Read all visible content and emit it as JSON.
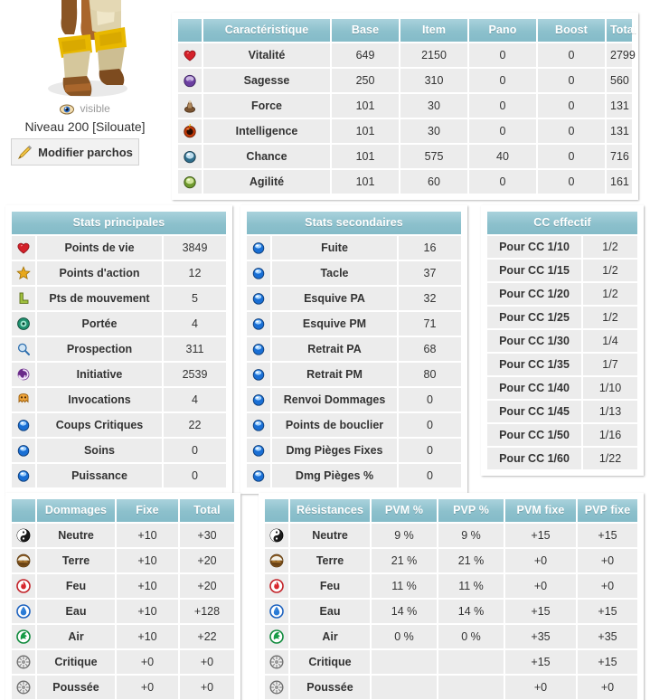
{
  "character": {
    "visibility_label": "visible",
    "visibility_icon": "eye-icon",
    "level_label": "Niveau 200 [Silouate]",
    "edit_button_label": "Modifier parchos",
    "edit_button_icon": "pencil-icon",
    "sprite_icon": "character-sprite"
  },
  "colors": {
    "header_teal": "#8cc0cc",
    "total_green_bg": "#e8f5d6",
    "total_green_text": "#4a6b2f",
    "label_gray": "#8d8d8d",
    "cell_bg": "#ececec",
    "label_bg": "#d9d9d9"
  },
  "caracteristiques": {
    "headers": [
      "Caractéristique",
      "Base",
      "Item",
      "Pano",
      "Boost",
      "Total"
    ],
    "rows": [
      {
        "icon": "heart-icon",
        "label": "Vitalité",
        "base": "649",
        "item": "2150",
        "pano": "0",
        "boost": "0",
        "total": "2799"
      },
      {
        "icon": "wisdom-orb-icon",
        "label": "Sagesse",
        "base": "250",
        "item": "310",
        "pano": "0",
        "boost": "0",
        "total": "560"
      },
      {
        "icon": "strength-icon",
        "label": "Force",
        "base": "101",
        "item": "30",
        "pano": "0",
        "boost": "0",
        "total": "131"
      },
      {
        "icon": "intelligence-icon",
        "label": "Intelligence",
        "base": "101",
        "item": "30",
        "pano": "0",
        "boost": "0",
        "total": "131"
      },
      {
        "icon": "chance-icon",
        "label": "Chance",
        "base": "101",
        "item": "575",
        "pano": "40",
        "boost": "0",
        "total": "716"
      },
      {
        "icon": "agility-icon",
        "label": "Agilité",
        "base": "101",
        "item": "60",
        "pano": "0",
        "boost": "0",
        "total": "161"
      }
    ]
  },
  "stats_principales": {
    "title": "Stats principales",
    "rows": [
      {
        "icon": "heart-icon",
        "label": "Points de vie",
        "value": "3849"
      },
      {
        "icon": "star-icon",
        "label": "Points d'action",
        "value": "12"
      },
      {
        "icon": "boot-icon",
        "label": "Pts de mouvement",
        "value": "5"
      },
      {
        "icon": "range-icon",
        "label": "Portée",
        "value": "4"
      },
      {
        "icon": "magnifier-icon",
        "label": "Prospection",
        "value": "311"
      },
      {
        "icon": "spiral-icon",
        "label": "Initiative",
        "value": "2539"
      },
      {
        "icon": "summon-icon",
        "label": "Invocations",
        "value": "4"
      },
      {
        "icon": "blue-orb-icon",
        "label": "Coups Critiques",
        "value": "22"
      },
      {
        "icon": "blue-orb-icon",
        "label": "Soins",
        "value": "0"
      },
      {
        "icon": "blue-orb-icon",
        "label": "Puissance",
        "value": "0"
      }
    ]
  },
  "stats_secondaires": {
    "title": "Stats secondaires",
    "rows": [
      {
        "icon": "blue-orb-icon",
        "label": "Fuite",
        "value": "16"
      },
      {
        "icon": "blue-orb-icon",
        "label": "Tacle",
        "value": "37"
      },
      {
        "icon": "blue-orb-icon",
        "label": "Esquive PA",
        "value": "32"
      },
      {
        "icon": "blue-orb-icon",
        "label": "Esquive PM",
        "value": "71"
      },
      {
        "icon": "blue-orb-icon",
        "label": "Retrait PA",
        "value": "68"
      },
      {
        "icon": "blue-orb-icon",
        "label": "Retrait PM",
        "value": "80"
      },
      {
        "icon": "blue-orb-icon",
        "label": "Renvoi Dommages",
        "value": "0"
      },
      {
        "icon": "blue-orb-icon",
        "label": "Points de bouclier",
        "value": "0"
      },
      {
        "icon": "blue-orb-icon",
        "label": "Dmg Pièges Fixes",
        "value": "0"
      },
      {
        "icon": "blue-orb-icon",
        "label": "Dmg Pièges %",
        "value": "0"
      }
    ]
  },
  "cc_effectif": {
    "title": "CC effectif",
    "rows": [
      {
        "label": "Pour CC 1/10",
        "value": "1/2"
      },
      {
        "label": "Pour CC 1/15",
        "value": "1/2"
      },
      {
        "label": "Pour CC 1/20",
        "value": "1/2"
      },
      {
        "label": "Pour CC 1/25",
        "value": "1/2"
      },
      {
        "label": "Pour CC 1/30",
        "value": "1/4"
      },
      {
        "label": "Pour CC 1/35",
        "value": "1/7"
      },
      {
        "label": "Pour CC 1/40",
        "value": "1/10"
      },
      {
        "label": "Pour CC 1/45",
        "value": "1/13"
      },
      {
        "label": "Pour CC 1/50",
        "value": "1/16"
      },
      {
        "label": "Pour CC 1/60",
        "value": "1/22"
      }
    ]
  },
  "dommages": {
    "headers": [
      "Dommages",
      "Fixe",
      "Total"
    ],
    "rows": [
      {
        "icon": "neutral-element-icon",
        "label": "Neutre",
        "fixe": "+10",
        "total": "+30"
      },
      {
        "icon": "earth-element-icon",
        "label": "Terre",
        "fixe": "+10",
        "total": "+20"
      },
      {
        "icon": "fire-element-icon",
        "label": "Feu",
        "fixe": "+10",
        "total": "+20"
      },
      {
        "icon": "water-element-icon",
        "label": "Eau",
        "fixe": "+10",
        "total": "+128"
      },
      {
        "icon": "air-element-icon",
        "label": "Air",
        "fixe": "+10",
        "total": "+22"
      },
      {
        "icon": "critical-icon",
        "label": "Critique",
        "fixe": "+0",
        "total": "+0"
      },
      {
        "icon": "push-icon",
        "label": "Poussée",
        "fixe": "+0",
        "total": "+0"
      }
    ]
  },
  "resistances": {
    "headers": [
      "Résistances",
      "PVM %",
      "PVP %",
      "PVM fixe",
      "PVP fixe"
    ],
    "rows": [
      {
        "icon": "neutral-element-icon",
        "label": "Neutre",
        "pvm_pct": "9 %",
        "pvp_pct": "9 %",
        "pvm_fixe": "+15",
        "pvp_fixe": "+15"
      },
      {
        "icon": "earth-element-icon",
        "label": "Terre",
        "pvm_pct": "21 %",
        "pvp_pct": "21 %",
        "pvm_fixe": "+0",
        "pvp_fixe": "+0"
      },
      {
        "icon": "fire-element-icon",
        "label": "Feu",
        "pvm_pct": "11 %",
        "pvp_pct": "11 %",
        "pvm_fixe": "+0",
        "pvp_fixe": "+0"
      },
      {
        "icon": "water-element-icon",
        "label": "Eau",
        "pvm_pct": "14 %",
        "pvp_pct": "14 %",
        "pvm_fixe": "+15",
        "pvp_fixe": "+15"
      },
      {
        "icon": "air-element-icon",
        "label": "Air",
        "pvm_pct": "0 %",
        "pvp_pct": "0 %",
        "pvm_fixe": "+35",
        "pvp_fixe": "+35"
      },
      {
        "icon": "critical-icon",
        "label": "Critique",
        "pvm_pct": "",
        "pvp_pct": "",
        "pvm_fixe": "+15",
        "pvp_fixe": "+15"
      },
      {
        "icon": "push-icon",
        "label": "Poussée",
        "pvm_pct": "",
        "pvp_pct": "",
        "pvm_fixe": "+0",
        "pvp_fixe": "+0"
      }
    ]
  }
}
